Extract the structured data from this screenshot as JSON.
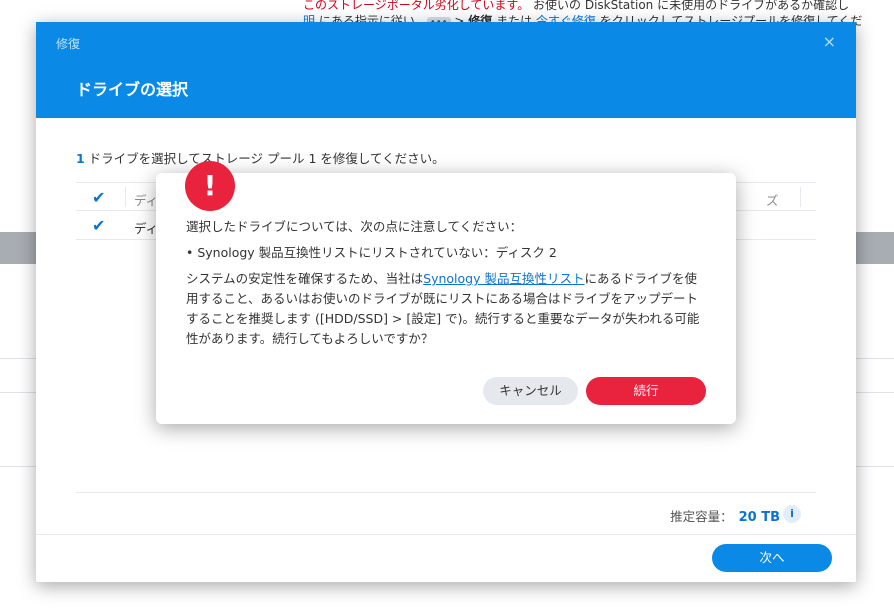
{
  "background": {
    "line1_warning": "このストレージポータル劣化しています。",
    "line1_rest": " お使いの DiskStation に未使用のドライブがあるか確認し",
    "line2_link": "明",
    "line2_text_a": " にある指示に従い、",
    "line2_dots": "•••",
    "line2_text_b": " > ",
    "line2_bold": "修復",
    "line2_text_c": " または ",
    "line2_link2": "今すぐ修復",
    "line2_text_d": " をクリックしてストレージプールを修復してくだ"
  },
  "modal": {
    "small_title": "修復",
    "close_icon": "×",
    "title": "ドライブの選択",
    "instruction_num": "1",
    "instruction_text": " ドライブを選択してストレージ プール 1 を修復してください。",
    "table": {
      "header_col": "ディ",
      "header_size": "ズ",
      "row_col": "ディ"
    },
    "capacity_label": "推定容量：",
    "capacity_value": "20 TB",
    "info_icon": "i",
    "next_button": "次へ"
  },
  "alert": {
    "icon": "!",
    "intro": "選択したドライブについては、次の点に注意してください：",
    "bullet": "• Synology 製品互換性リストにリストされていない：ディスク 2",
    "para_a": "システムの安定性を確保するため、当社は",
    "para_link": "Synology 製品互換性リスト",
    "para_b": "にあるドライブを使用すること、あるいはお使いのドライブが既にリストにある場合はドライブをアップデートすることを推奨します ([HDD/SSD] > [設定] で)。続行すると重要なデータが失われる可能性があります。続行してもよろしいですか？",
    "cancel_button": "キャンセル",
    "continue_button": "続行"
  }
}
